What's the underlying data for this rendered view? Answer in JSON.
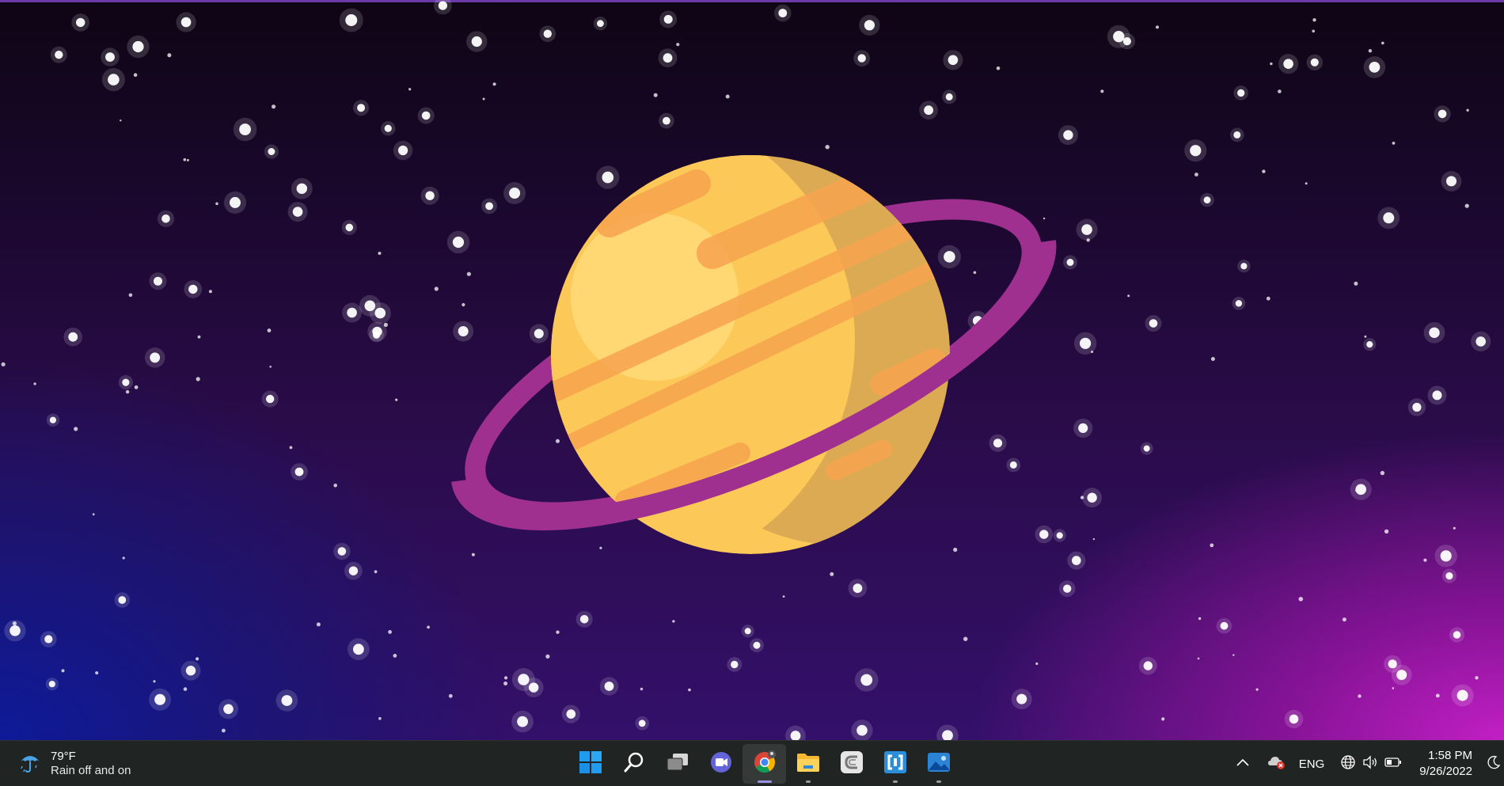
{
  "wallpaper": {
    "colors": {
      "planet": "#fcc857",
      "planet_shadow": "#d8a653",
      "planet_stripes": "#f7a44f",
      "ring": "#a0308f",
      "stars": "#ffffff"
    }
  },
  "taskbar": {
    "weather": {
      "temperature": "79°F",
      "condition": "Rain off and on",
      "icon": "umbrella-rain-icon"
    },
    "apps": [
      {
        "name": "Start",
        "icon": "windows-start-icon"
      },
      {
        "name": "Search",
        "icon": "search-icon"
      },
      {
        "name": "Task View",
        "icon": "task-view-icon"
      },
      {
        "name": "Chat",
        "icon": "teams-chat-icon"
      },
      {
        "name": "Google Chrome",
        "icon": "chrome-icon",
        "active": true
      },
      {
        "name": "File Explorer",
        "icon": "folder-icon",
        "running": true
      },
      {
        "name": "CyberLink",
        "icon": "cyberlink-icon"
      },
      {
        "name": "App",
        "icon": "bracket-app-icon",
        "running": true
      },
      {
        "name": "Photos",
        "icon": "photos-icon",
        "running": true
      }
    ],
    "tray": {
      "language": "ENG",
      "time": "1:58 PM",
      "date": "9/26/2022"
    }
  }
}
